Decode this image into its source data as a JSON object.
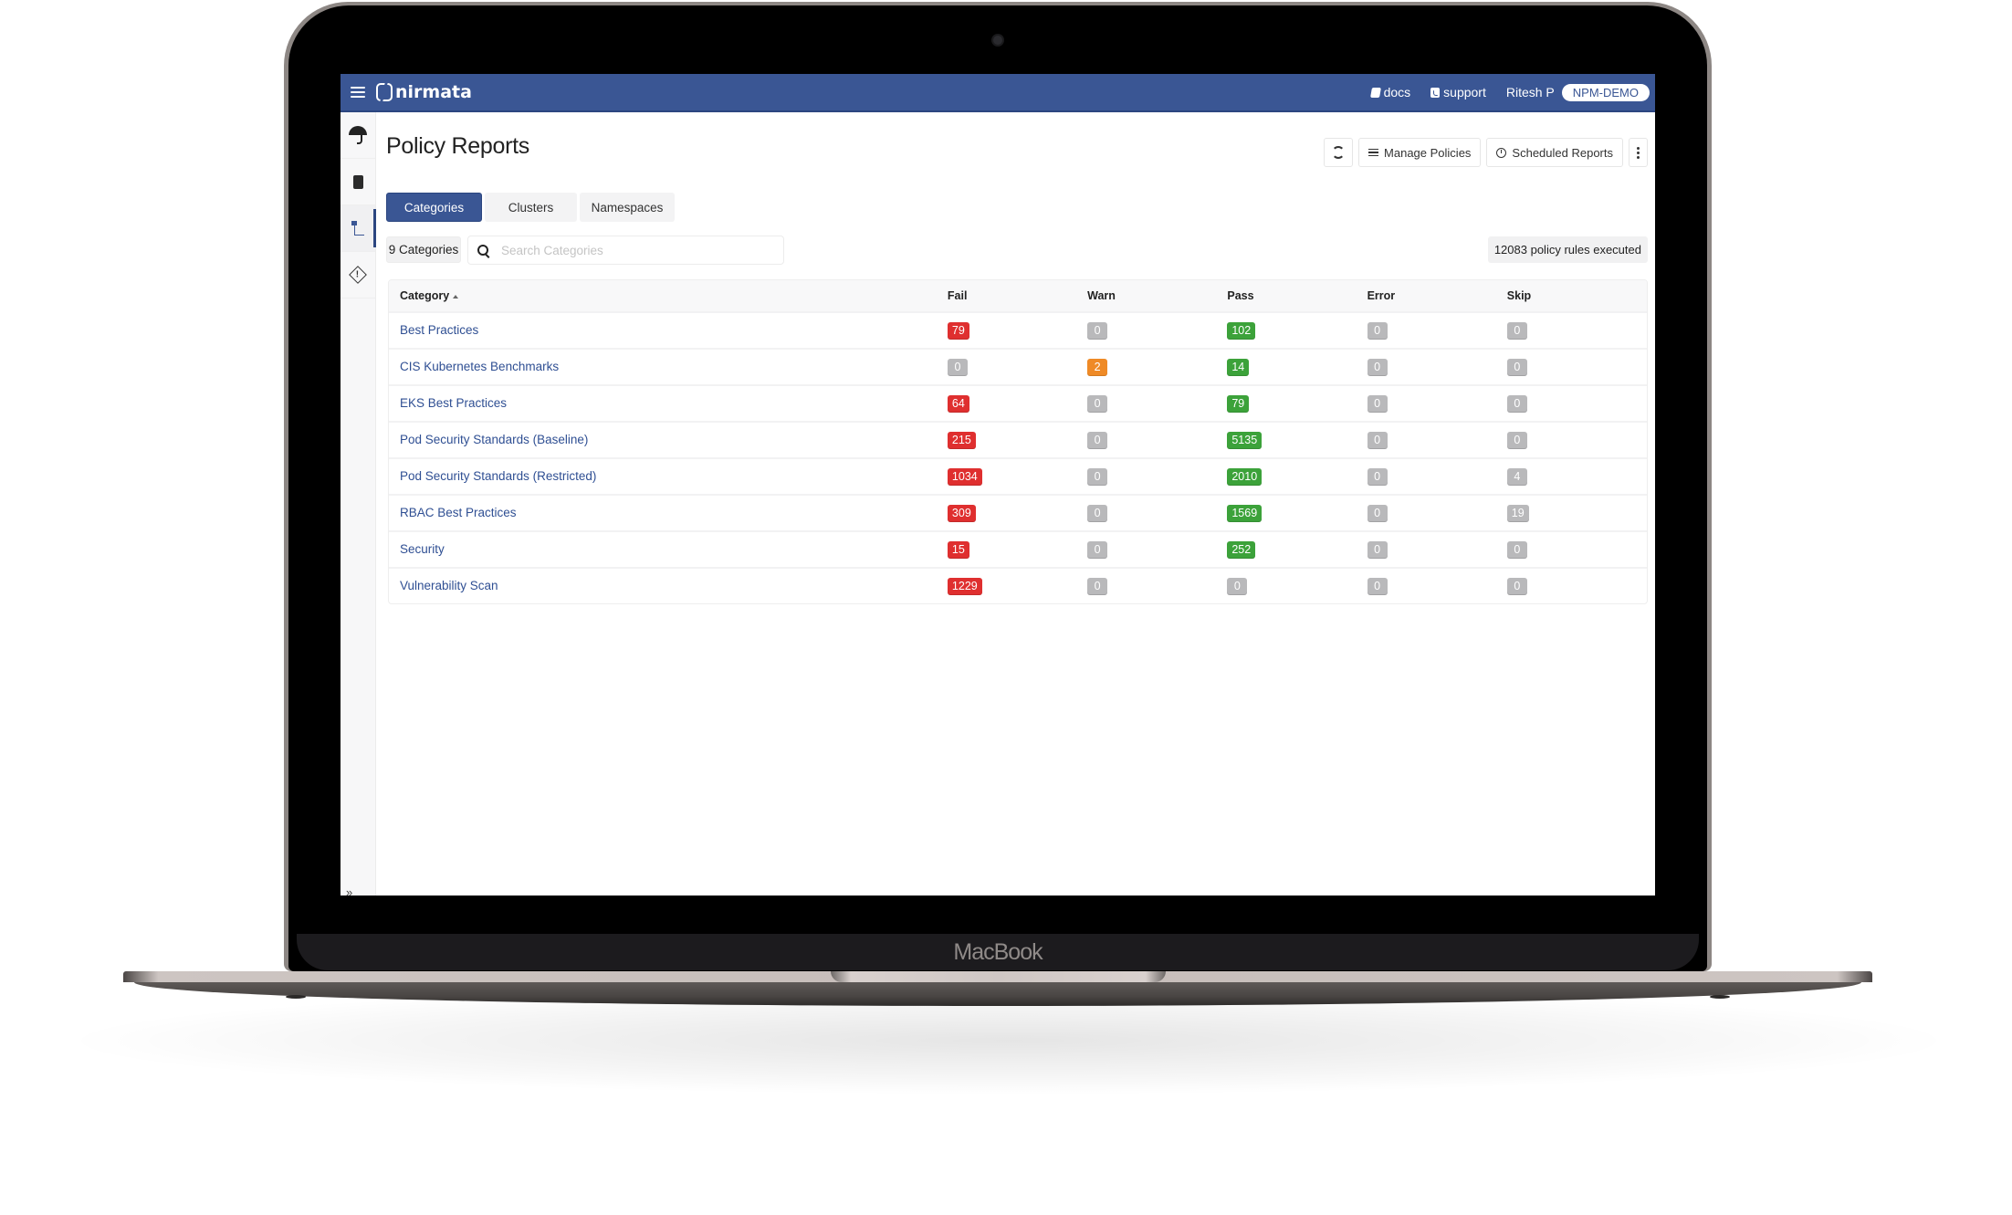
{
  "device": {
    "brand_label": "MacBook"
  },
  "topnav": {
    "logo_text": "nirmata",
    "docs_label": "docs",
    "support_label": "support",
    "user_name": "Ritesh P",
    "tenant_badge": "NPM-DEMO",
    "colors": {
      "nav_bg": "#3a5694"
    }
  },
  "sidebar": {
    "items": [
      {
        "icon": "umbrella-icon",
        "active": false
      },
      {
        "icon": "server-icon",
        "active": false
      },
      {
        "icon": "policy-tree-icon",
        "active": true
      },
      {
        "icon": "warning-diamond-icon",
        "active": false
      }
    ],
    "collapse_label": "»"
  },
  "page": {
    "title": "Policy Reports",
    "actions": {
      "refresh_icon": "refresh-icon",
      "manage_policies_label": "Manage Policies",
      "scheduled_reports_label": "Scheduled Reports",
      "more_icon": "kebab-icon"
    },
    "tabs": [
      {
        "label": "Categories",
        "active": true
      },
      {
        "label": "Clusters",
        "active": false
      },
      {
        "label": "Namespaces",
        "active": false
      }
    ],
    "category_count_label": "9 Categories",
    "search": {
      "value": "",
      "placeholder": "Search Categories"
    },
    "executed_label": "12083 policy rules executed"
  },
  "table": {
    "columns": [
      "Category",
      "Fail",
      "Warn",
      "Pass",
      "Error",
      "Skip"
    ],
    "sort": {
      "column": "Category",
      "direction": "asc"
    },
    "rows": [
      {
        "category": "Best Practices",
        "fail": 79,
        "warn": 0,
        "pass": 102,
        "error": 0,
        "skip": 0
      },
      {
        "category": "CIS Kubernetes Benchmarks",
        "fail": 0,
        "warn": 2,
        "pass": 14,
        "error": 0,
        "skip": 0
      },
      {
        "category": "EKS Best Practices",
        "fail": 64,
        "warn": 0,
        "pass": 79,
        "error": 0,
        "skip": 0
      },
      {
        "category": "Pod Security Standards (Baseline)",
        "fail": 215,
        "warn": 0,
        "pass": 5135,
        "error": 0,
        "skip": 0
      },
      {
        "category": "Pod Security Standards (Restricted)",
        "fail": 1034,
        "warn": 0,
        "pass": 2010,
        "error": 0,
        "skip": 4
      },
      {
        "category": "RBAC Best Practices",
        "fail": 309,
        "warn": 0,
        "pass": 1569,
        "error": 0,
        "skip": 19
      },
      {
        "category": "Security",
        "fail": 15,
        "warn": 0,
        "pass": 252,
        "error": 0,
        "skip": 0
      },
      {
        "category": "Vulnerability Scan",
        "fail": 1229,
        "warn": 0,
        "pass": 0,
        "error": 0,
        "skip": 0
      }
    ],
    "badge_colors": {
      "fail": "#df2f2f",
      "warn": "#ef8a26",
      "pass": "#3ca23a",
      "zero": "#b9b9bb"
    }
  }
}
